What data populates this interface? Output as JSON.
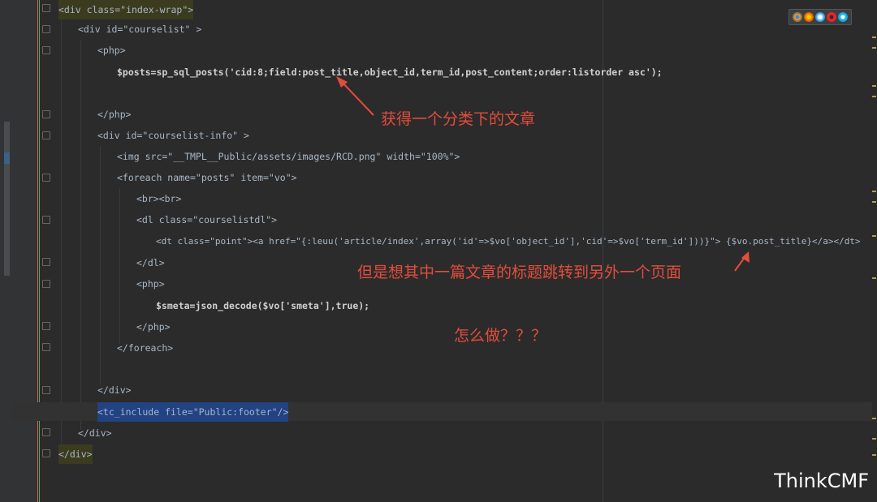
{
  "code_lines": [
    {
      "id": "l1",
      "text": "<div class=\"index-wrap\">"
    },
    {
      "id": "l2",
      "text": "<div id=\"courselist\" >"
    },
    {
      "id": "l3",
      "text": "<php>"
    },
    {
      "id": "l4",
      "text": "$posts=sp_sql_posts('cid:8;field:post_title,object_id,term_id,post_content;order:listorder asc');"
    },
    {
      "id": "l5",
      "text": "</php>"
    },
    {
      "id": "l6",
      "text": "<div id=\"courselist-info\" >"
    },
    {
      "id": "l7",
      "text": "<img src=\"__TMPL__Public/assets/images/RCD.png\" width=\"100%\">"
    },
    {
      "id": "l8",
      "text": "<foreach name=\"posts\" item=\"vo\">"
    },
    {
      "id": "l9",
      "text": "<br><br>"
    },
    {
      "id": "l10",
      "text": "<dl class=\"courselistdl\">"
    },
    {
      "id": "l11",
      "text": "<dt class=\"point\"><a href=\"{:leuu('article/index',array('id'=>$vo['object_id'],'cid'=>$vo['term_id']))}\"> {$vo.post_title}</a></dt>"
    },
    {
      "id": "l12",
      "text": "</dl>"
    },
    {
      "id": "l13",
      "text": "<php>"
    },
    {
      "id": "l14",
      "text": "$smeta=json_decode($vo['smeta'],true);"
    },
    {
      "id": "l15",
      "text": "</php>"
    },
    {
      "id": "l16",
      "text": "</foreach>"
    },
    {
      "id": "l17",
      "text": "</div>"
    },
    {
      "id": "l18",
      "text": "<tc_include file=\"Public:footer\"/>"
    },
    {
      "id": "l19",
      "text": "</div>"
    },
    {
      "id": "l20",
      "text": "</div>"
    }
  ],
  "annotations": {
    "note1": "获得一个分类下的文章",
    "note2": "但是想其中一篇文章的标题跳转到另外一个页面",
    "note3": "怎么做？？？"
  },
  "browser_icons": [
    "chrome-icon",
    "firefox-icon",
    "safari-icon",
    "opera-icon",
    "ie-icon"
  ],
  "watermark": "ThinkCMF",
  "colors": {
    "background": "#2b2b2b",
    "tag": "#e8bf6a",
    "string": "#a5c25c",
    "annotation": "#e24d3c"
  }
}
